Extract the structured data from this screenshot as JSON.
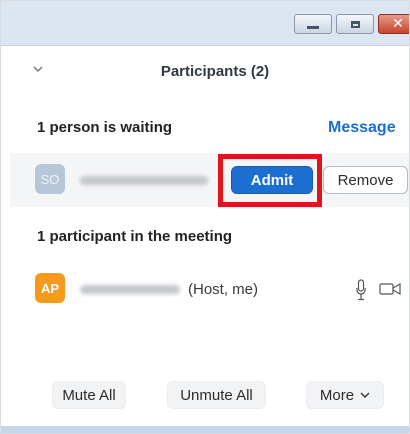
{
  "window": {
    "controls": {
      "minimize_icon": "minimize-icon",
      "maximize_icon": "maximize-icon",
      "close_glyph": "✕"
    }
  },
  "header": {
    "title": "Participants (2)",
    "collapse_icon": "chevron-down-icon"
  },
  "waiting": {
    "label": "1 person is waiting",
    "message_link": "Message",
    "person": {
      "initials": "SO",
      "name": "",
      "admit_label": "Admit",
      "remove_label": "Remove"
    }
  },
  "meeting": {
    "label": "1 participant in the meeting",
    "participant": {
      "initials": "AP",
      "name": "",
      "role": "(Host, me)",
      "mic_icon": "microphone-icon",
      "video_icon": "video-camera-icon"
    }
  },
  "footer": {
    "mute_all": "Mute All",
    "unmute_all": "Unmute All",
    "more": "More"
  },
  "colors": {
    "accent_blue": "#1c6ed1",
    "link_blue": "#1b6fd1",
    "highlight_red": "#e0141a",
    "host_avatar": "#f59a1c",
    "waiting_avatar": "#b7c7da"
  }
}
